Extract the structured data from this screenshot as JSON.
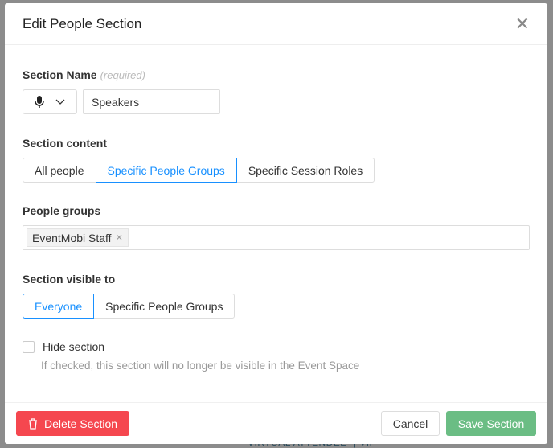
{
  "background": {
    "tags": [
      "VIRTUAL ATTENDEE",
      "VIP"
    ]
  },
  "modal": {
    "title": "Edit People Section",
    "section_name": {
      "label": "Section Name",
      "required": "(required)",
      "icon": "microphone-icon",
      "value": "Speakers"
    },
    "section_content": {
      "label": "Section content",
      "options": [
        "All people",
        "Specific People Groups",
        "Specific Session Roles"
      ],
      "selected": "Specific People Groups"
    },
    "people_groups": {
      "label": "People groups",
      "tags": [
        "EventMobi Staff"
      ]
    },
    "visible_to": {
      "label": "Section visible to",
      "options": [
        "Everyone",
        "Specific People Groups"
      ],
      "selected": "Everyone"
    },
    "hide": {
      "label": "Hide section",
      "checked": false,
      "hint": "If checked, this section will no longer be visible in the Event Space"
    },
    "footer": {
      "delete": "Delete Section",
      "cancel": "Cancel",
      "save": "Save Section"
    }
  },
  "colors": {
    "primary": "#1890ff",
    "danger": "#f5474f",
    "success": "#6bbd84"
  }
}
